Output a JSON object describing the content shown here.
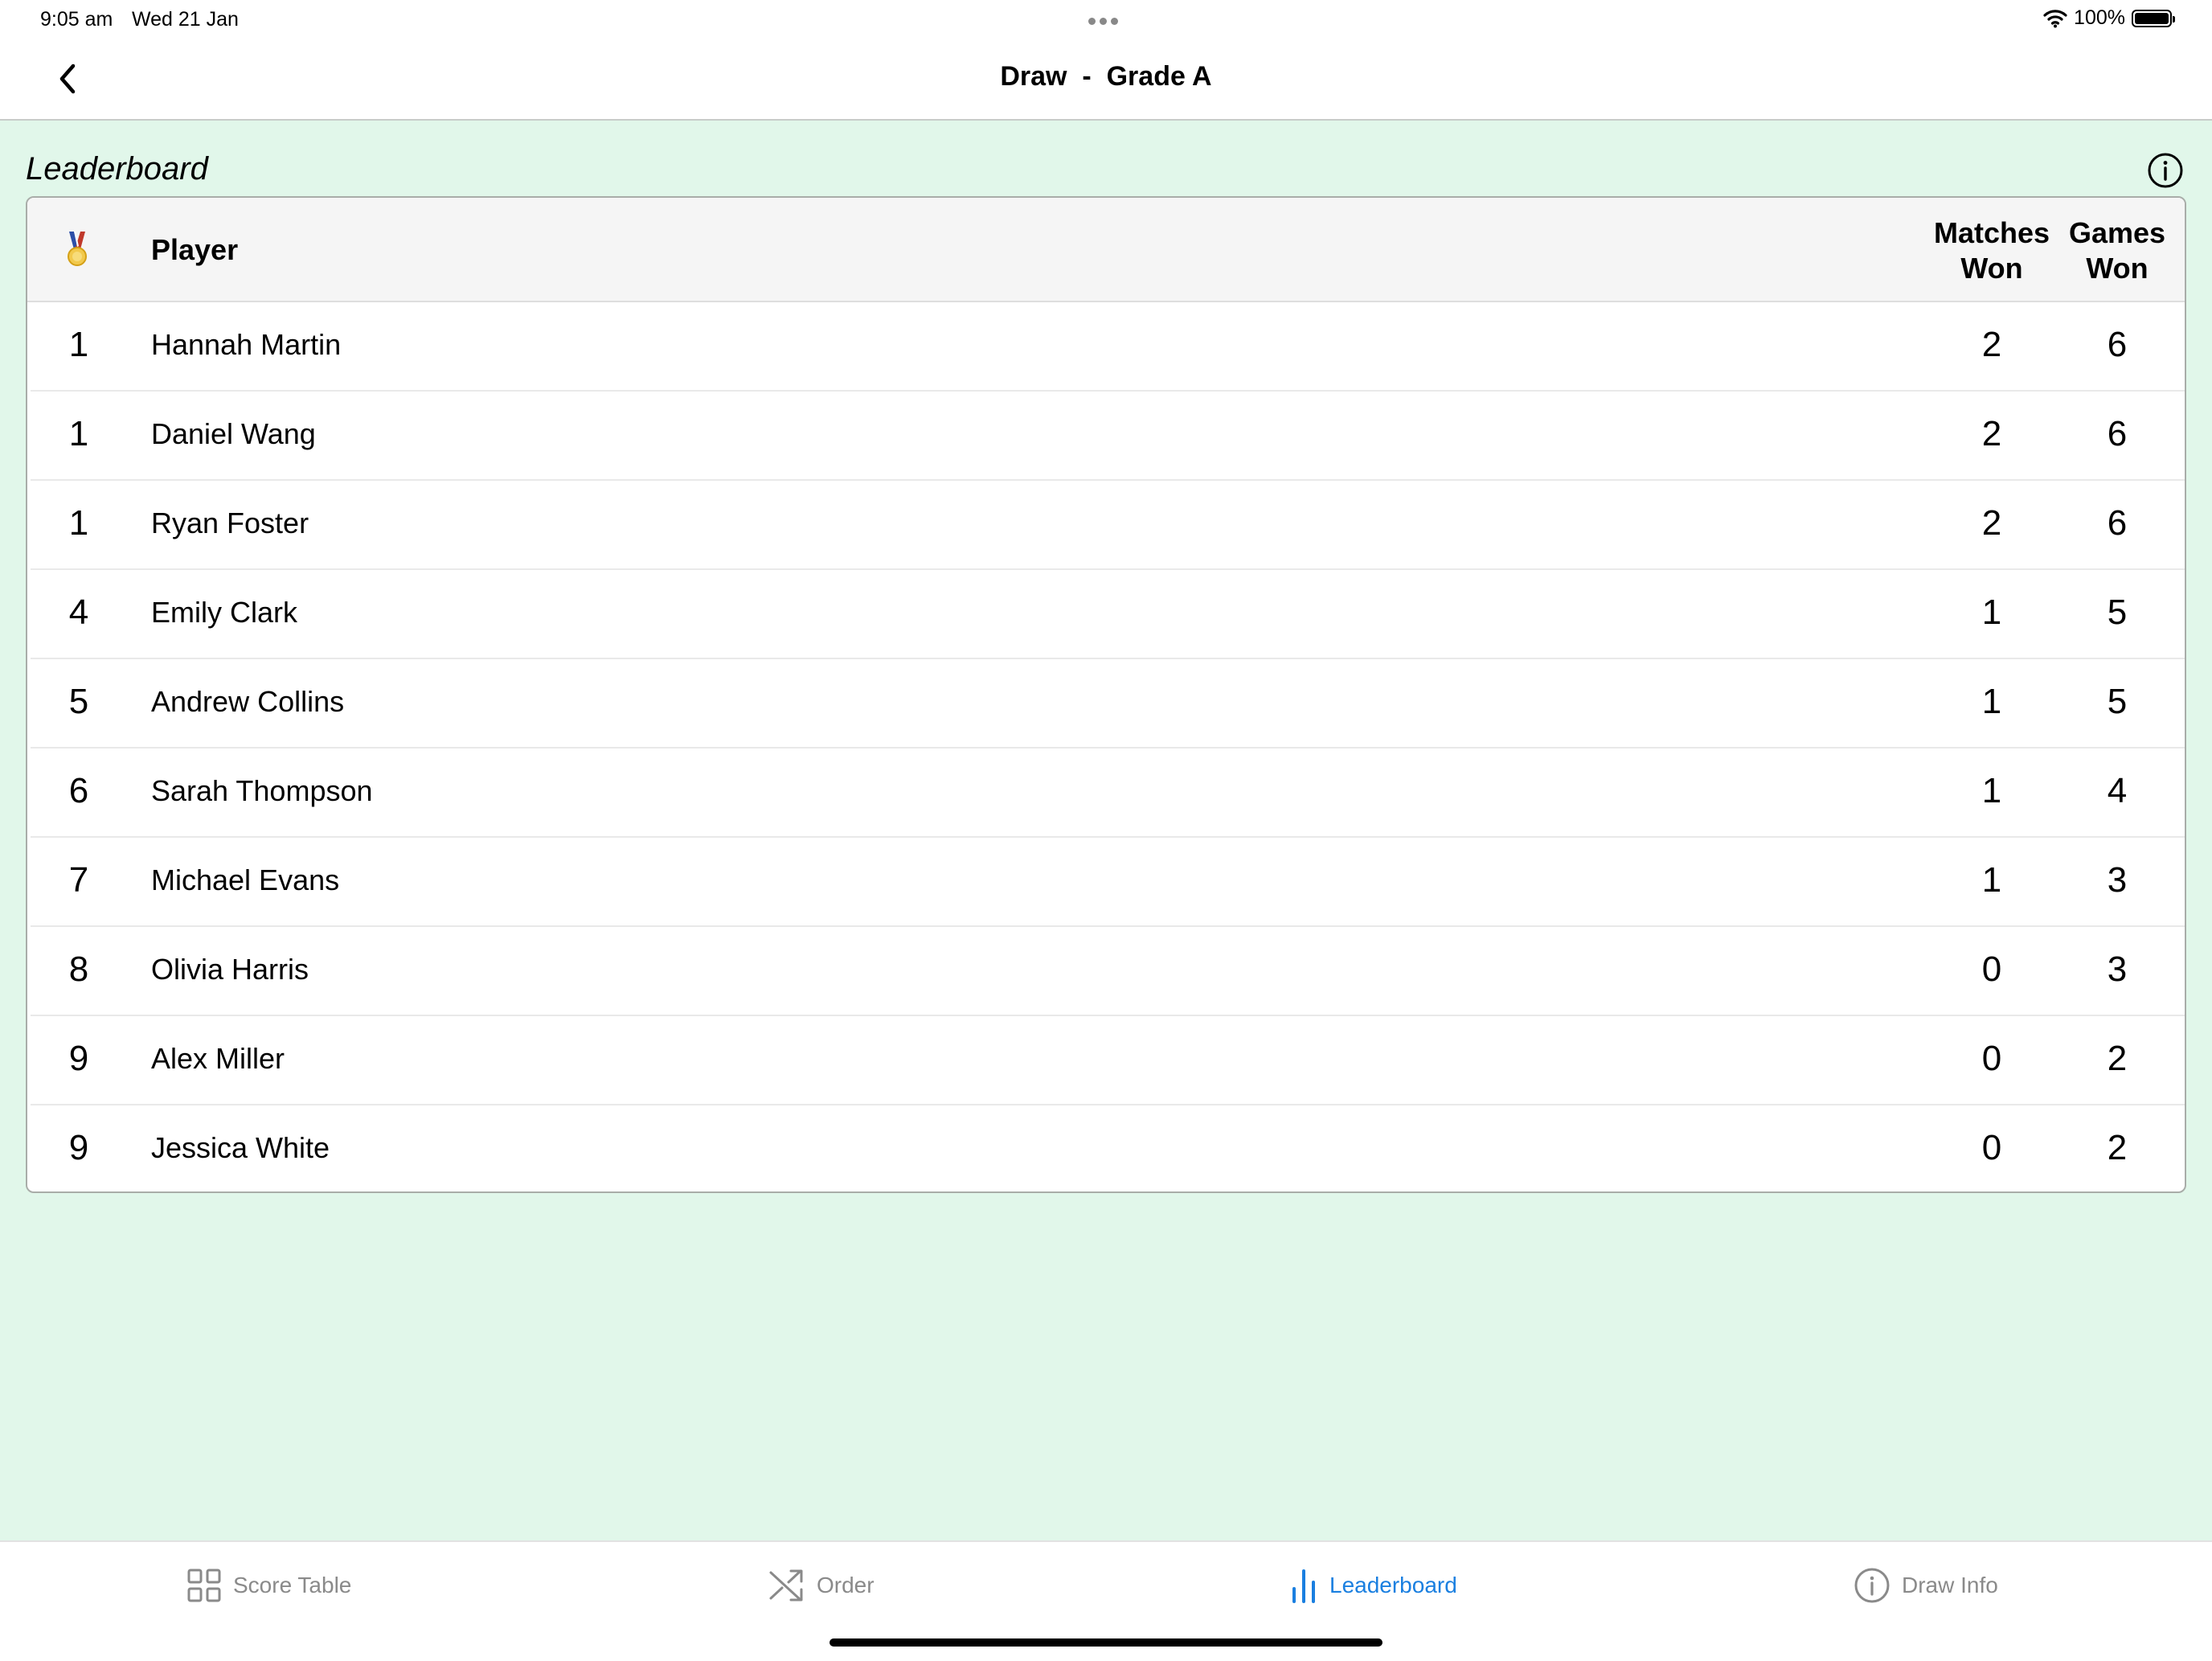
{
  "status_bar": {
    "time": "9:05 am",
    "date": "Wed 21 Jan",
    "battery": "100%"
  },
  "nav": {
    "title": "Draw  -  Grade A"
  },
  "section": {
    "title": "Leaderboard"
  },
  "table": {
    "headers": {
      "player": "Player",
      "matches_won": [
        "Matches",
        "Won"
      ],
      "games_won": [
        "Games",
        "Won"
      ]
    },
    "rows": [
      {
        "rank": "1",
        "name": "Hannah Martin",
        "matches_won": "2",
        "games_won": "6"
      },
      {
        "rank": "1",
        "name": "Daniel Wang",
        "matches_won": "2",
        "games_won": "6"
      },
      {
        "rank": "1",
        "name": "Ryan Foster",
        "matches_won": "2",
        "games_won": "6"
      },
      {
        "rank": "4",
        "name": "Emily Clark",
        "matches_won": "1",
        "games_won": "5"
      },
      {
        "rank": "5",
        "name": "Andrew Collins",
        "matches_won": "1",
        "games_won": "5"
      },
      {
        "rank": "6",
        "name": "Sarah Thompson",
        "matches_won": "1",
        "games_won": "4"
      },
      {
        "rank": "7",
        "name": "Michael Evans",
        "matches_won": "1",
        "games_won": "3"
      },
      {
        "rank": "8",
        "name": "Olivia Harris",
        "matches_won": "0",
        "games_won": "3"
      },
      {
        "rank": "9",
        "name": "Alex Miller",
        "matches_won": "0",
        "games_won": "2"
      },
      {
        "rank": "9",
        "name": "Jessica White",
        "matches_won": "0",
        "games_won": "2"
      }
    ]
  },
  "tabs": [
    {
      "label": "Score Table",
      "icon": "grid-icon",
      "active": false
    },
    {
      "label": "Order",
      "icon": "shuffle-icon",
      "active": false
    },
    {
      "label": "Leaderboard",
      "icon": "bar-chart-icon",
      "active": true
    },
    {
      "label": "Draw Info",
      "icon": "info-icon",
      "active": false
    }
  ],
  "colors": {
    "background": "#e1f7ea",
    "accent": "#1a7fe0",
    "tab_inactive": "#8a8a8a"
  }
}
